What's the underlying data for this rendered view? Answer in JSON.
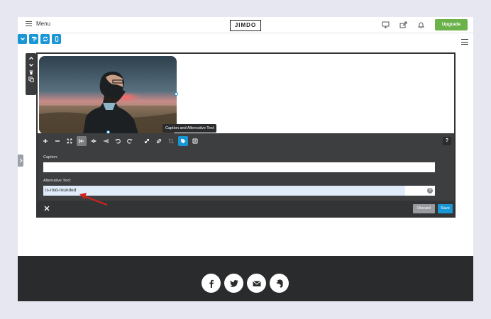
{
  "topbar": {
    "menu_label": "Menu",
    "logo_text": "JIMDO",
    "upgrade_label": "Upgrade",
    "icons": [
      "desktop-preview-icon",
      "share-icon",
      "bell-icon"
    ]
  },
  "mode_bar": {
    "buttons": [
      "chevron-down-icon",
      "paint-roller-icon",
      "sync-icon",
      "mobile-icon"
    ]
  },
  "image_editor": {
    "tooltip": "Caption and Alternative Text",
    "toolbar": [
      "zoom-in-icon",
      "zoom-out-icon",
      "fit-icon",
      "align-left-icon",
      "align-center-icon",
      "align-right-icon",
      "rotate-left-icon",
      "rotate-right-icon",
      "expand-icon",
      "link-icon",
      "crop-icon",
      "tag-icon",
      "swap-image-icon"
    ],
    "help_label": "?",
    "caption_label": "Caption:",
    "caption_value": "",
    "alt_label": "Alternative Text:",
    "alt_value": "is-mid-rounded",
    "alt_help": "?",
    "discard_label": "Discard",
    "save_label": "Save"
  },
  "footer": {
    "social_icons": [
      "facebook-icon",
      "twitter-icon",
      "mail-icon",
      "evernote-icon"
    ]
  },
  "colors": {
    "accent": "#1a96d4",
    "upgrade": "#6bb24a",
    "panel": "#3d3e40",
    "footer": "#2a2b2d",
    "annotation_arrow": "#d4211b"
  }
}
